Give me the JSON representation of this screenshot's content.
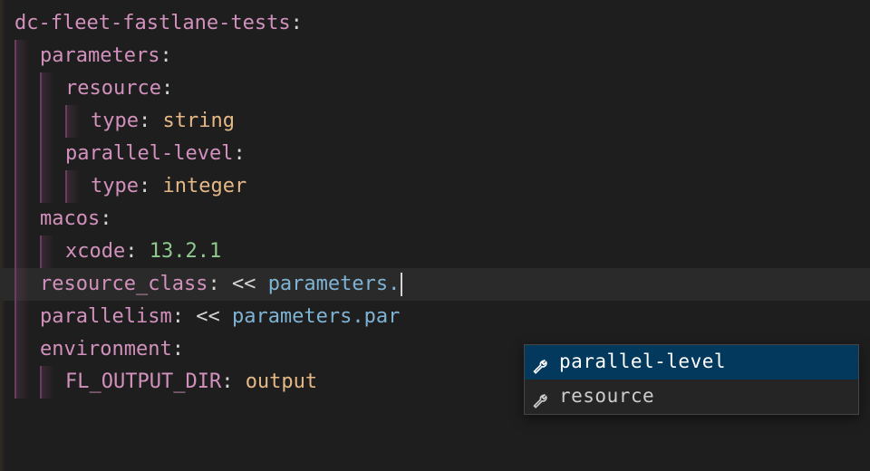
{
  "code": {
    "jobName": "dc-fleet-fastlane-tests",
    "parametersKey": "parameters",
    "resourceKey": "resource",
    "typeKey": "type",
    "stringType": "string",
    "parallelLevelKey": "parallel-level",
    "integerType": "integer",
    "macosKey": "macos",
    "xcodeKey": "xcode",
    "xcodeVersion": "13.2.1",
    "resourceClassKey": "resource_class",
    "templateOpen": "<< ",
    "parametersRef": "parameters.",
    "parallelismKey": "parallelism",
    "parallelismPartial": "par",
    "environmentKey": "environment",
    "flOutputDirKey": "FL_OUTPUT_DIR",
    "outputValue": "output"
  },
  "autocomplete": {
    "items": [
      {
        "label": "parallel-level",
        "selected": true
      },
      {
        "label": "resource",
        "selected": false
      }
    ]
  }
}
